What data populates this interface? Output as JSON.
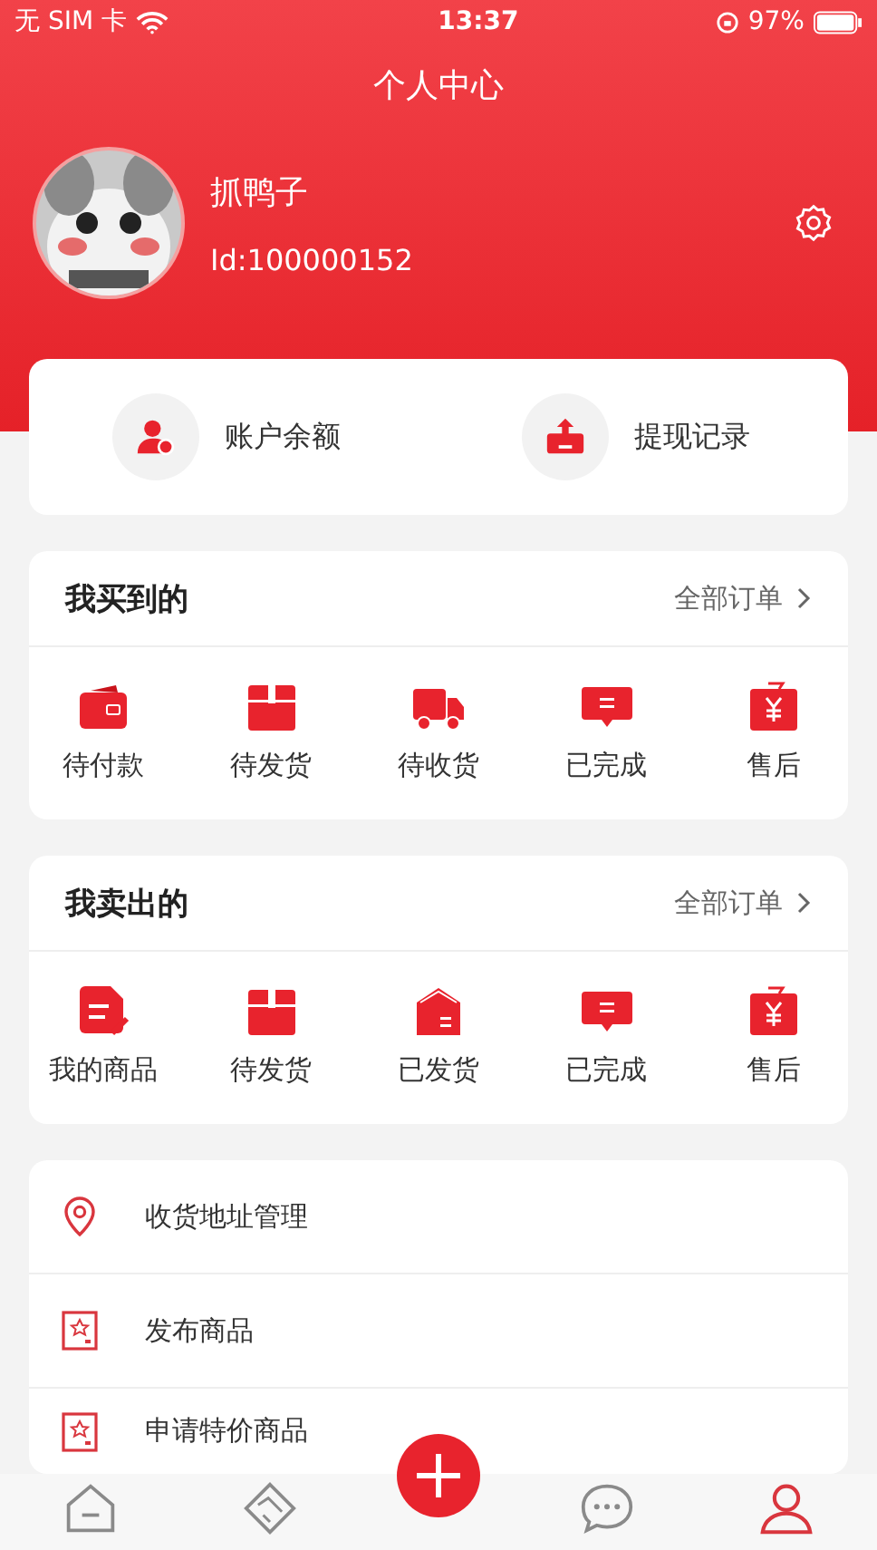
{
  "status_bar": {
    "carrier": "无 SIM 卡",
    "time": "13:37",
    "battery": "97%"
  },
  "header": {
    "title": "个人中心",
    "username": "抓鸭子",
    "user_id": "Id:100000152"
  },
  "wallet": [
    {
      "label": "账户余额",
      "kind": "balance"
    },
    {
      "label": "提现记录",
      "kind": "withdraw"
    }
  ],
  "sections": [
    {
      "title": "我买到的",
      "link": "全部订单",
      "items": [
        {
          "label": "待付款",
          "kind": "wallet"
        },
        {
          "label": "待发货",
          "kind": "box"
        },
        {
          "label": "待收货",
          "kind": "truck"
        },
        {
          "label": "已完成",
          "kind": "message"
        },
        {
          "label": "售后",
          "kind": "refund"
        }
      ]
    },
    {
      "title": "我卖出的",
      "link": "全部订单",
      "items": [
        {
          "label": "我的商品",
          "kind": "doc"
        },
        {
          "label": "待发货",
          "kind": "box"
        },
        {
          "label": "已发货",
          "kind": "shipped"
        },
        {
          "label": "已完成",
          "kind": "message"
        },
        {
          "label": "售后",
          "kind": "refund"
        }
      ]
    }
  ],
  "menu": [
    {
      "label": "收货地址管理",
      "kind": "pin"
    },
    {
      "label": "发布商品",
      "kind": "tag"
    },
    {
      "label": "申请特价商品",
      "kind": "tag"
    }
  ],
  "tab_bar": [
    {
      "kind": "home",
      "selected": false
    },
    {
      "kind": "handshake",
      "selected": false
    },
    {
      "kind": "publish",
      "selected": false
    },
    {
      "kind": "chat",
      "selected": false
    },
    {
      "kind": "profile",
      "selected": true
    }
  ]
}
